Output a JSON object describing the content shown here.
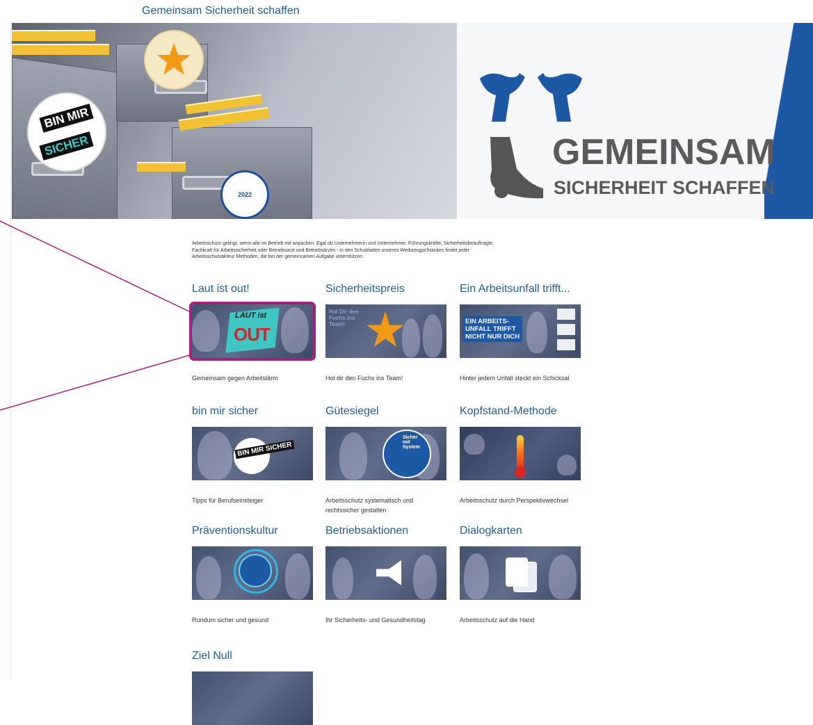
{
  "page": {
    "title": "Gemeinsam Sicherheit schaffen"
  },
  "hero": {
    "logo_line1": "GEMEINSAM",
    "logo_line2": "SICHERHEIT SCHAFFEN",
    "sticker_binmir_1": "BIN MIR",
    "sticker_binmir_2": "SICHER"
  },
  "intro": {
    "text": "Arbeitsschutz gelingt, wenn alle im Betrieb mit anpacken. Egal ob Unternehmerin und Unternehmer, Führungskräfte, Sicherheitsbeauftragte, Fachkraft für Arbeitssicherheit oder Betriebsarzt und Betriebsärztin - in den Schubladen unseres Werkzeugschrankes findet jeder Arbeitsschutzakteur Methoden, die bei der gemeinsamen Aufgabe unterstützen."
  },
  "tiles": [
    {
      "title": "Laut ist out!",
      "caption": "Gemeinsam gegen Arbeitslärm",
      "img_text1": "LAUT ist",
      "img_text2": "OUT"
    },
    {
      "title": "Sicherheitspreis",
      "caption": "Hol dir den Fuchs ins Team!",
      "img_text1": "Hol Dir den Fuchs ins Team!"
    },
    {
      "title": "Ein Arbeitsunfall trifft...",
      "caption": "Hinter jedem Unfall steckt ein Schicksal",
      "img_text1": "EIN ARBEITS-\nUNFALL TRIFFT\nNICHT NUR DICH"
    },
    {
      "title": "bin mir sicher",
      "caption": "Tipps für Berufseinsteiger",
      "img_text1": "BIN MIR SICHER"
    },
    {
      "title": "Gütesiegel",
      "caption": "Arbeitsschutz systematisch und rechtssicher gestalten",
      "img_text1": "Sicher mit System"
    },
    {
      "title": "Kopfstand-Methode",
      "caption": "Arbeitsschutz durch Perspektivwechsel"
    },
    {
      "title": "Präventionskultur",
      "caption": "Rundum sicher und gesund"
    },
    {
      "title": "Betriebsaktionen",
      "caption": "Ihr Sicherheits- und Gesundheitstag"
    },
    {
      "title": "Dialogkarten",
      "caption": "Arbeitsschutz auf die Hand"
    },
    {
      "title": "Ziel Null",
      "caption": ""
    }
  ],
  "colors": {
    "heading": "#1f5e95",
    "highlight": "#a3207e",
    "brand_blue": "#1d58a5"
  }
}
